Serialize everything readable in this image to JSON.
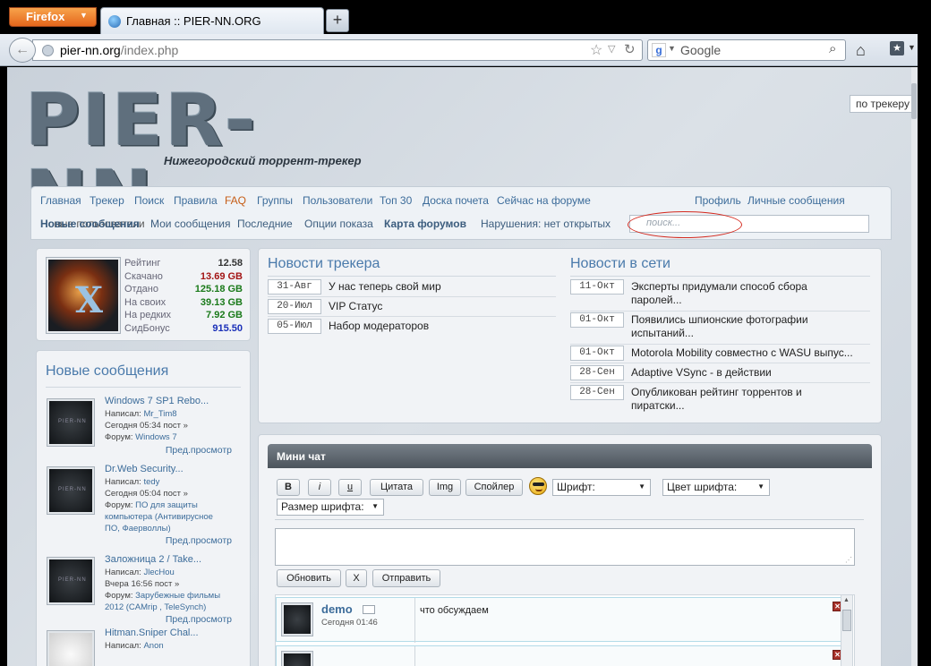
{
  "browser": {
    "menu_button": "Firefox",
    "tab_title": "Главная :: PIER-NN.ORG",
    "new_tab": "+",
    "url_host": "pier-nn.org",
    "url_path": "/index.php",
    "search_engine": "Google",
    "search_placeholder": "Google"
  },
  "site": {
    "logo": "PIER-NN",
    "tagline": "Нижегородский торрент-трекер"
  },
  "menu": {
    "items": [
      "Главная",
      "Трекер",
      "Поиск",
      "Правила",
      "FAQ",
      "Группы",
      "Пользователи",
      "Топ 30",
      "Доска почета",
      "Сейчас на форуме"
    ],
    "right": [
      "Профиль",
      "Личные сообщения"
    ],
    "row2": {
      "new_posts": "Новые сообщения",
      "new_posts_overlap": "Новые пользователи",
      "my_posts": "Мои сообщения",
      "latest": "Последние",
      "view_options": "Опции показа",
      "forum_map": "Карта форумов",
      "violations": "Нарушения: нет открытых"
    },
    "search_placeholder": "поиск...",
    "search_scope": "по трекеру"
  },
  "user": {
    "stats": [
      {
        "label": "Рейтинг",
        "value": "12.58",
        "color": "#333333"
      },
      {
        "label": "Скачано",
        "value": "13.69 GB",
        "color": "#a31515"
      },
      {
        "label": "Отдано",
        "value": "125.18 GB",
        "color": "#1a7a1a"
      },
      {
        "label": "На своих",
        "value": "39.13 GB",
        "color": "#1a7a1a"
      },
      {
        "label": "На редких",
        "value": "7.92 GB",
        "color": "#1a7a1a"
      },
      {
        "label": "СидБонус",
        "value": "915.50",
        "color": "#1a2fb8"
      }
    ]
  },
  "new_messages": {
    "title": "Новые сообщения",
    "preview_label": "Пред.просмотр",
    "items": [
      {
        "title": "Windows 7 SP1 Rebo...",
        "author_prefix": "Написал: ",
        "author": "Mr_Tim8",
        "time": "Сегодня 05:34 пост »",
        "forum_prefix": "Форум: ",
        "forum": "Windows 7"
      },
      {
        "title": "Dr.Web Security...",
        "author_prefix": "Написал: ",
        "author": "tedy",
        "time": "Сегодня 05:04 пост »",
        "forum_prefix": "Форум: ",
        "forum": "ПО для защиты",
        "forum2": "компьютера (Антивирусное",
        "forum3": "ПО, Фаерволлы)"
      },
      {
        "title": "Заложница 2 / Take...",
        "author_prefix": "Написал: ",
        "author": "JlecHou",
        "time": "Вчера 16:56 пост »",
        "forum_prefix": "Форум: ",
        "forum": "Зарубежные фильмы",
        "forum2": "2012 (CAMrip , TeleSynch)"
      },
      {
        "title": "Hitman.Sniper Chal...",
        "author_prefix": "Написал: ",
        "author": "Anon"
      }
    ]
  },
  "news": {
    "tracker_title": "Новости трекера",
    "tracker": [
      {
        "date": "31-Авг",
        "text": "У нас теперь свой мир"
      },
      {
        "date": "20-Июл",
        "text": "VIP Статус"
      },
      {
        "date": "05-Июл",
        "text": "Набор модераторов"
      }
    ],
    "net_title": "Новости в сети",
    "net": [
      {
        "date": "11-Окт",
        "text1": "Эксперты придумали способ сбора",
        "text2": "паролей..."
      },
      {
        "date": "01-Окт",
        "text1": "Появились шпионские фотографии",
        "text2": "испытаний..."
      },
      {
        "date": "01-Окт",
        "text1": "Motorola Mobility совместно с WASU выпус...",
        "text2": ""
      },
      {
        "date": "28-Сен",
        "text1": "Adaptive VSync - в действии",
        "text2": ""
      },
      {
        "date": "28-Сен",
        "text1": "Опубликован рейтинг торрентов и",
        "text2": "пиратски..."
      }
    ]
  },
  "chat": {
    "title": "Мини чат",
    "btn_b": "B",
    "btn_i": "i",
    "btn_u": "u",
    "btn_quote": "Цитата",
    "btn_img": "Img",
    "btn_spoiler": "Спойлер",
    "font_label": "Шрифт:",
    "color_label": "Цвет шрифта:",
    "size_label": "Размер шрифта:",
    "refresh": "Обновить",
    "clear": "X",
    "send": "Отправить",
    "messages": [
      {
        "name": "demo",
        "time": "Сегодня 01:46",
        "text": "что обсуждаем"
      }
    ]
  }
}
